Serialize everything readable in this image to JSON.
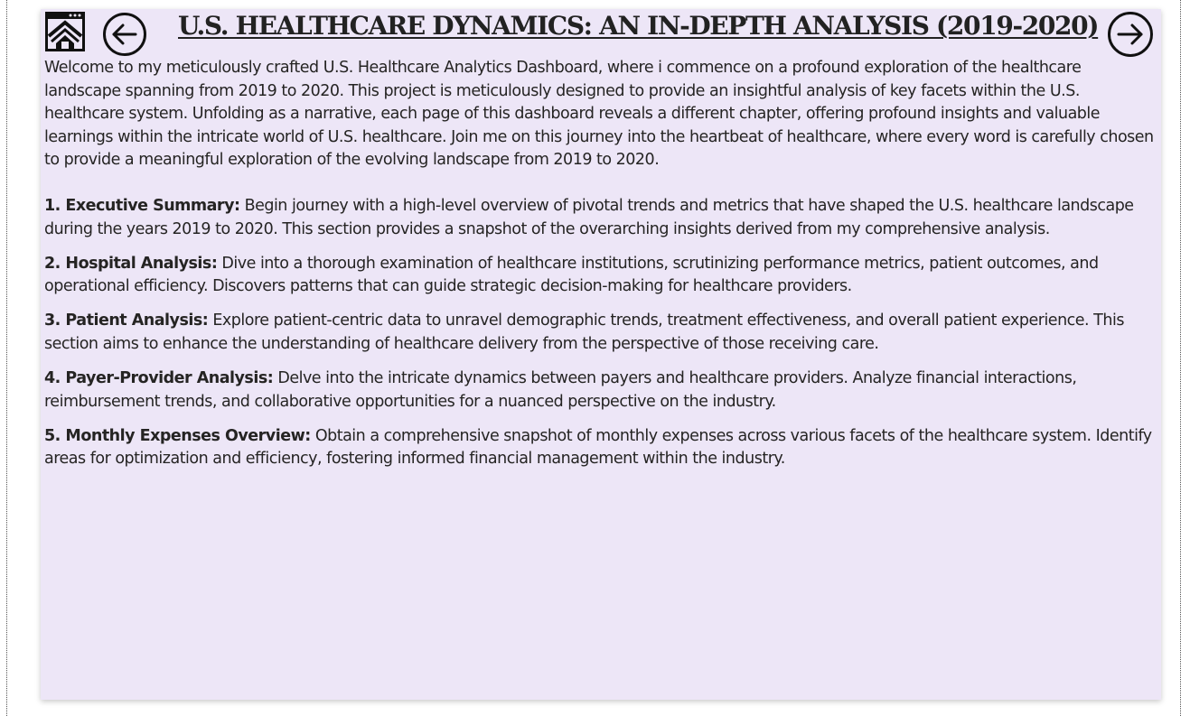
{
  "header": {
    "title": "U.S. HEALTHCARE DYNAMICS: AN IN-DEPTH ANALYSIS (2019-2020)",
    "home_icon": "home-dashboard-icon",
    "back_icon": "arrow-left-circle-icon",
    "next_icon": "arrow-right-circle-icon"
  },
  "intro": "Welcome to my meticulously crafted U.S. Healthcare Analytics Dashboard, where i commence on a profound exploration of the healthcare landscape spanning from 2019 to 2020. This project is meticulously designed to provide an insightful analysis of key facets within the U.S. healthcare system. Unfolding as a narrative, each page of this dashboard reveals a different chapter, offering profound insights and valuable learnings within the intricate world of U.S. healthcare. Join me on this journey into the heartbeat of healthcare, where every word is carefully chosen to provide a meaningful exploration of the evolving landscape from 2019 to 2020.",
  "sections": [
    {
      "heading": "1. Executive Summary:",
      "text": "Begin journey with a high-level overview of pivotal trends and metrics that have shaped the U.S. healthcare landscape during the years 2019 to 2020. This section provides a snapshot of the overarching insights derived from my comprehensive analysis."
    },
    {
      "heading": "2. Hospital Analysis:",
      "text": "Dive into a thorough examination of healthcare institutions, scrutinizing performance metrics, patient outcomes, and operational efficiency. Discovers patterns that can guide strategic decision-making for healthcare providers."
    },
    {
      "heading": "3. Patient Analysis:",
      "text": "Explore patient-centric data to unravel demographic trends, treatment effectiveness, and overall patient experience. This section aims to enhance the understanding of healthcare delivery from the perspective of those receiving care."
    },
    {
      "heading": "4. Payer-Provider Analysis:",
      "text": "Delve into the intricate dynamics between payers and healthcare providers. Analyze financial interactions, reimbursement trends, and collaborative opportunities for a nuanced perspective on the industry."
    },
    {
      "heading": "5. Monthly Expenses Overview:",
      "text": "Obtain a comprehensive snapshot of monthly expenses across various facets of the healthcare system. Identify areas for optimization and efficiency, fostering informed financial management within the industry."
    }
  ],
  "colors": {
    "canvas_background": "#ede6f7",
    "text": "#252423",
    "icon": "#111111"
  }
}
